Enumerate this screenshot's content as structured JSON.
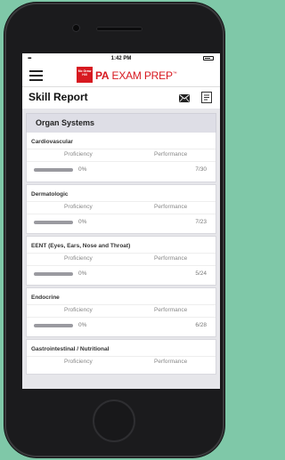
{
  "status_bar": {
    "time": "1:42 PM"
  },
  "app": {
    "logo_badge": "Mc Graw Hill",
    "brand_bold": "PA",
    "brand_rest": " EXAM PREP",
    "brand_mark": "™"
  },
  "page": {
    "title": "Skill Report"
  },
  "section": {
    "title": "Organ Systems"
  },
  "columns": {
    "proficiency": "Proficiency",
    "performance": "Performance"
  },
  "skills": [
    {
      "name": "Cardiovascular",
      "proficiency_pct": "0%",
      "performance": "7/30",
      "proficiency": 0
    },
    {
      "name": "Dermatologic",
      "proficiency_pct": "0%",
      "performance": "7/23",
      "proficiency": 0
    },
    {
      "name": "EENT (Eyes, Ears, Nose and Throat)",
      "proficiency_pct": "0%",
      "performance": "5/24",
      "proficiency": 0
    },
    {
      "name": "Endocrine",
      "proficiency_pct": "0%",
      "performance": "6/28",
      "proficiency": 0
    },
    {
      "name": "Gastrointestinal / Nutritional",
      "proficiency_pct": "",
      "performance": "",
      "proficiency": 0
    }
  ],
  "colors": {
    "brand_red": "#d71920",
    "page_bg": "#7fc8a8",
    "bar_track": "#9a9aa0"
  },
  "icons": [
    "menu-icon",
    "mail-icon",
    "document-icon"
  ]
}
